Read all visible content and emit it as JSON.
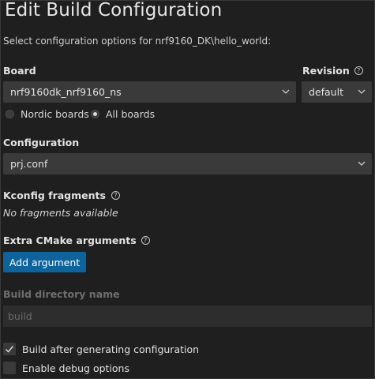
{
  "header": {
    "title": "Edit Build Configuration",
    "subtitle": "Select configuration options for nrf9160_DK\\hello_world:"
  },
  "board": {
    "label": "Board",
    "selected": "nrf9160dk_nrf9160_ns",
    "options": [
      {
        "label": "Nordic boards",
        "checked": false
      },
      {
        "label": "All boards",
        "checked": true
      }
    ]
  },
  "revision": {
    "label": "Revision",
    "selected": "default"
  },
  "configuration": {
    "label": "Configuration",
    "selected": "prj.conf"
  },
  "kconfig": {
    "label": "Kconfig fragments",
    "empty_text": "No fragments available"
  },
  "cmake": {
    "label": "Extra CMake arguments",
    "add_button": "Add argument"
  },
  "build_dir": {
    "label": "Build directory name",
    "value": "build"
  },
  "checkboxes": [
    {
      "label": "Build after generating configuration",
      "checked": true
    },
    {
      "label": "Enable debug options",
      "checked": false
    }
  ],
  "colors": {
    "background": "#1f1f1f",
    "accent": "#0e639c",
    "input": "#3a3a3a"
  }
}
